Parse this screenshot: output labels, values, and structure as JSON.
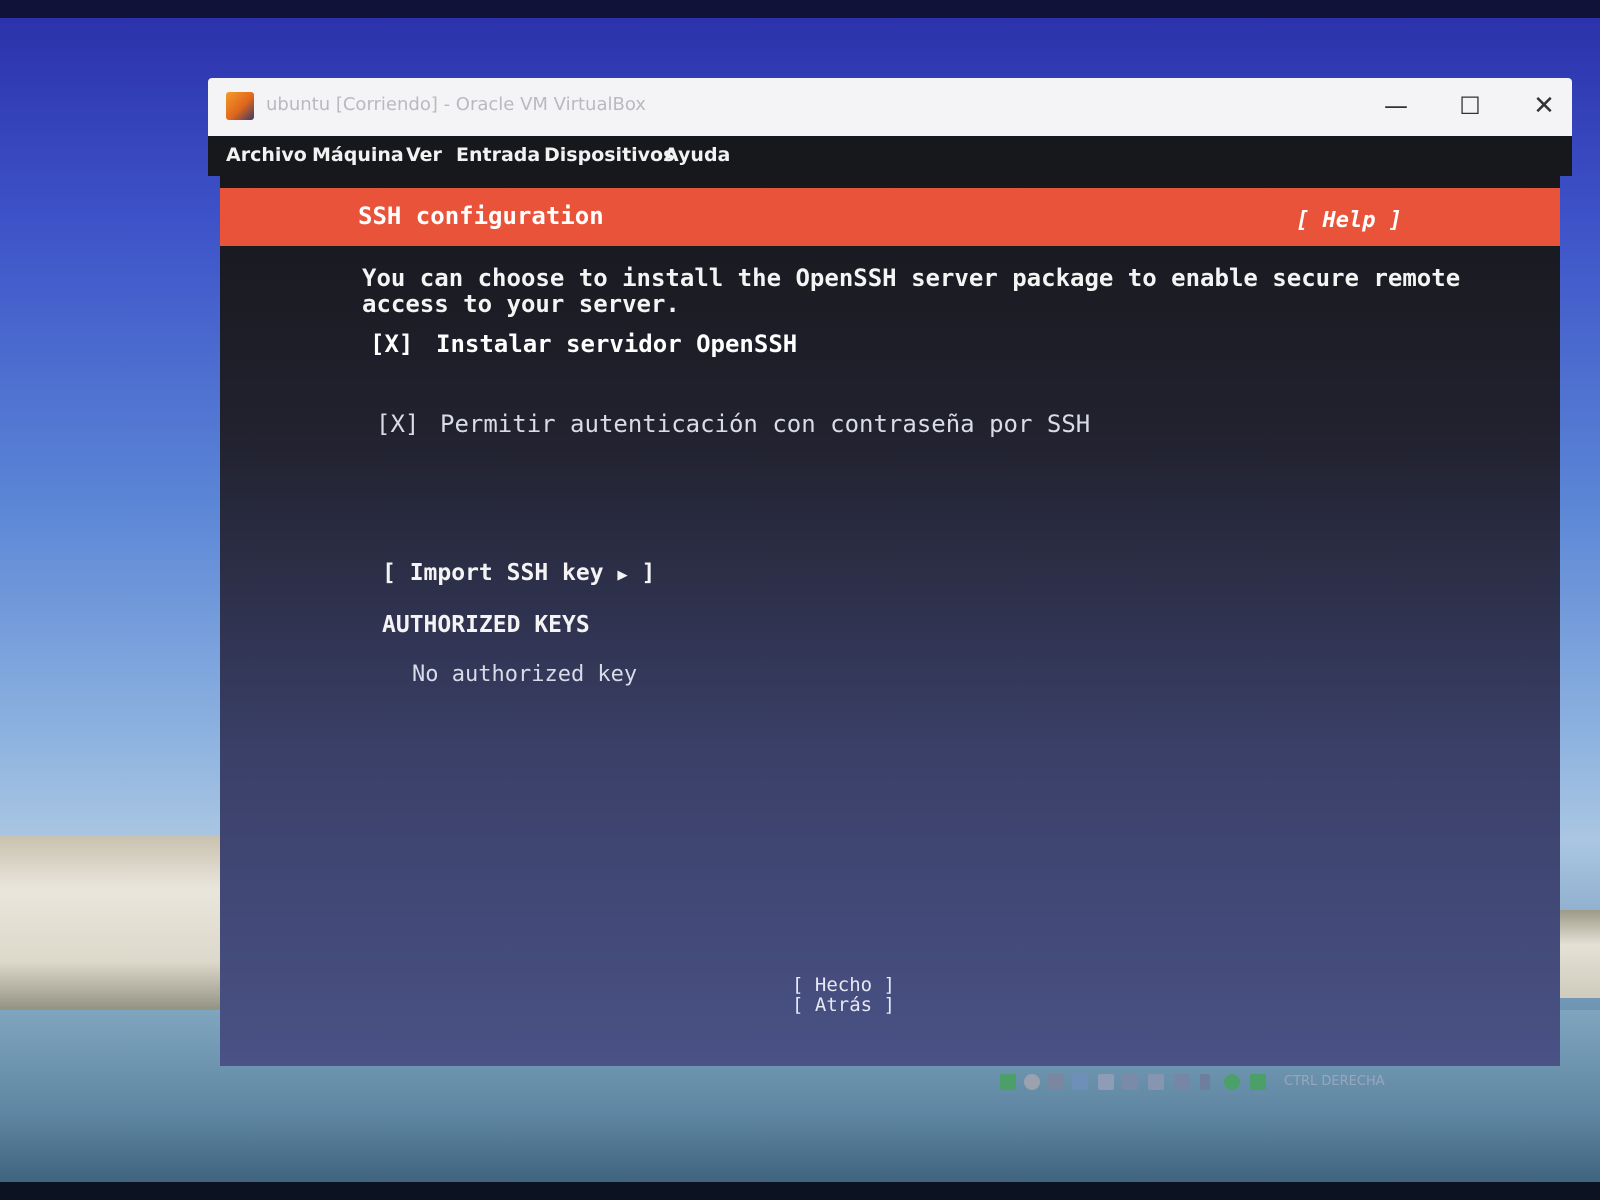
{
  "window": {
    "title": "ubuntu [Corriendo] - Oracle VM VirtualBox",
    "controls": {
      "minimize": "—",
      "maximize": "☐",
      "close": "✕"
    }
  },
  "menubar": {
    "items": [
      "Archivo",
      "Máquina",
      "Ver",
      "Entrada",
      "Dispositivos",
      "Ayuda"
    ]
  },
  "installer": {
    "header_title": "SSH configuration",
    "help_label": "[ Help ]",
    "description_lines": [
      "You can choose to install the OpenSSH server package to enable secure remote",
      "access to your server."
    ],
    "options": [
      {
        "checkbox": "[X]",
        "label": "Instalar servidor OpenSSH"
      },
      {
        "checkbox": "[X]",
        "label": "Permitir autenticación con contraseña por SSH"
      }
    ],
    "import_button": {
      "open": "[ Import SSH key",
      "arrow": "▶",
      "close": "]"
    },
    "authorized_keys_heading": "AUTHORIZED KEYS",
    "no_keys_text": "No authorized key",
    "footer_buttons": [
      "[ Hecho       ]",
      "[ Atrás       ]"
    ]
  },
  "statusbar": {
    "host_key_label": "CTRL DERECHA",
    "icons": [
      "disk-icon",
      "optical-icon",
      "audio-icon",
      "network-icon",
      "usb-icon",
      "shared-folder-icon",
      "display-icon",
      "recording-icon",
      "cpu-icon",
      "mouse-icon",
      "keyboard-icon"
    ]
  },
  "colors": {
    "header_bar": "#e9533a",
    "menubar": "#17181c",
    "titlebar": "#f4f4f6"
  }
}
